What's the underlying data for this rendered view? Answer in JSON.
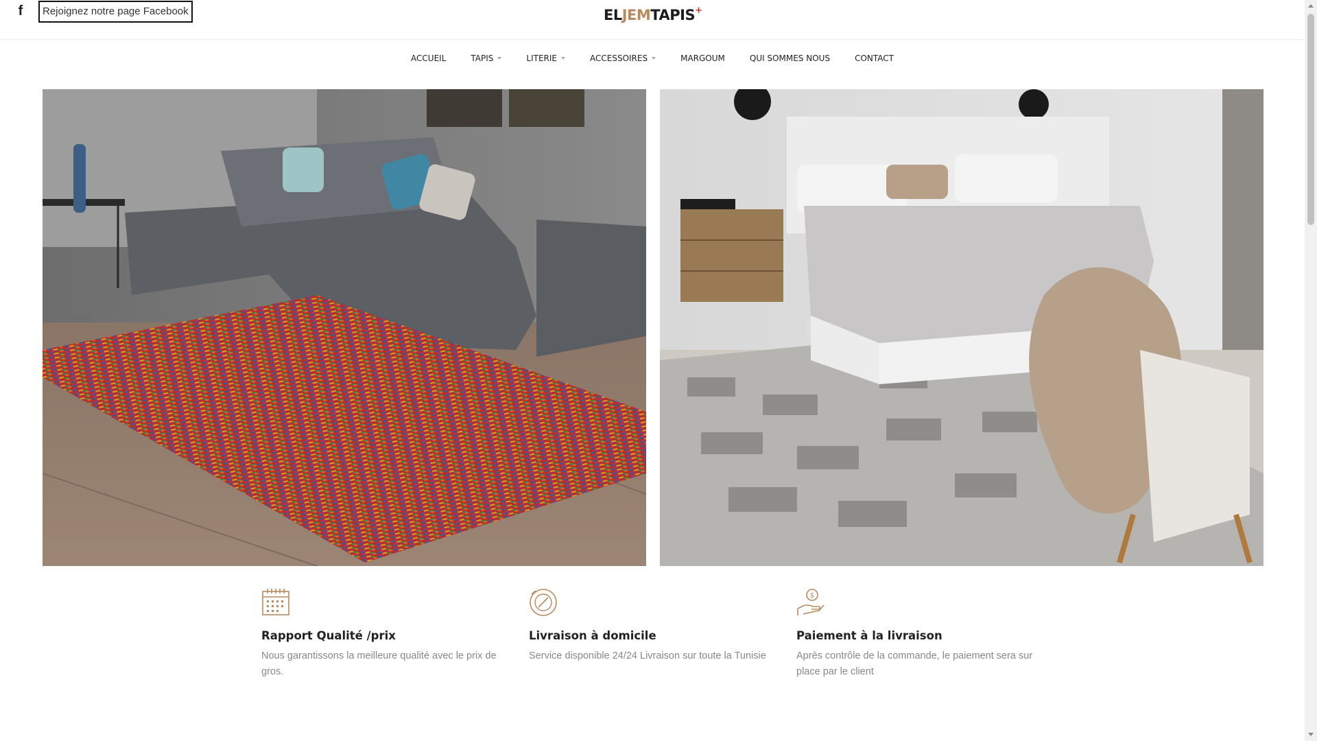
{
  "topbar": {
    "facebook_icon": "facebook-f-icon",
    "facebook_glyph": "f",
    "facebook_link": "Rejoignez notre page Facebook"
  },
  "logo": {
    "part1": "EL",
    "part2": "JEM",
    "part3": "TAPIS",
    "plus": "+",
    "accent_color": "#b98a5e"
  },
  "nav": {
    "items": [
      {
        "label": "ACCUEIL",
        "dropdown": false
      },
      {
        "label": "TAPIS",
        "dropdown": true
      },
      {
        "label": "LITERIE",
        "dropdown": true
      },
      {
        "label": "ACCESSOIRES",
        "dropdown": true
      },
      {
        "label": "MARGOUM",
        "dropdown": false
      },
      {
        "label": "QUI SOMMES NOUS",
        "dropdown": false
      },
      {
        "label": "CONTACT",
        "dropdown": false
      }
    ]
  },
  "hero": {
    "left_image": "living-room-colorful-rug-photo",
    "right_image": "bedroom-grey-rug-photo"
  },
  "features": [
    {
      "icon": "calendar-icon",
      "title": "Rapport Qualité /prix",
      "desc": "Nous garantissons la meilleure qualité avec le prix de gros."
    },
    {
      "icon": "delivery-compass-icon",
      "title": "Livraison à domicile",
      "desc": "Service disponible 24/24 Livraison sur toute la Tunisie"
    },
    {
      "icon": "hand-money-icon",
      "title": "Paiement à la livraison",
      "desc": "Après contrôle de la commande, le paiement sera sur place par le client"
    }
  ],
  "colors": {
    "icon_accent": "#b98a5e",
    "text_dark": "#222222",
    "text_muted": "#888888"
  }
}
